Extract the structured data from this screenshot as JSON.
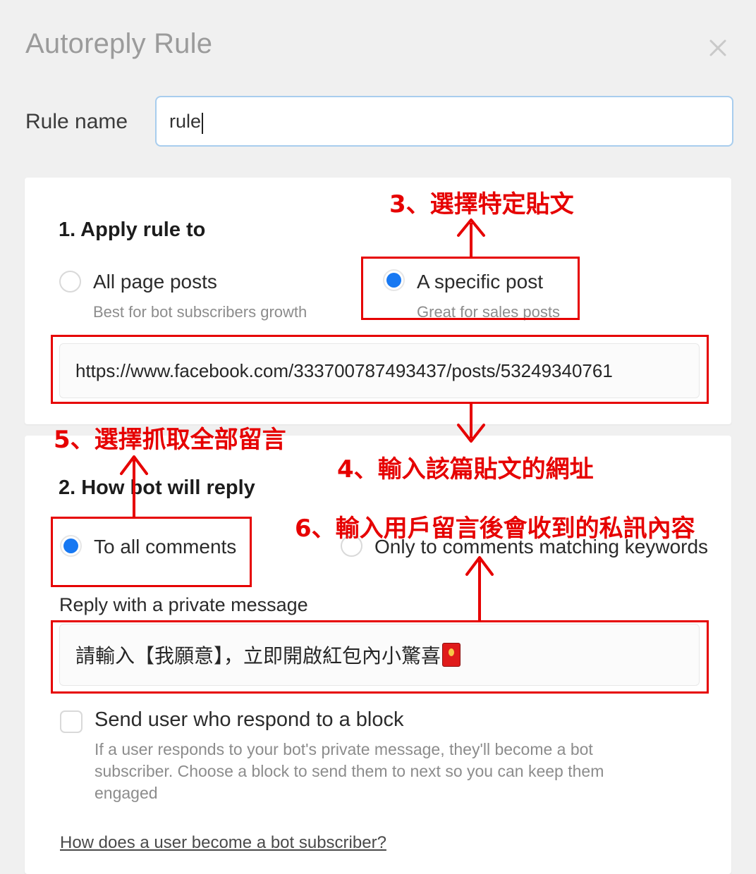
{
  "modal": {
    "title": "Autoreply Rule",
    "close_icon": "close-icon"
  },
  "rule_name": {
    "label": "Rule name",
    "value": "rule",
    "placeholder": "Rule name"
  },
  "apply_section": {
    "heading": "1. Apply rule to",
    "options": [
      {
        "label": "All page posts",
        "sub": "Best for bot subscribers growth",
        "selected": false
      },
      {
        "label": "A specific post",
        "sub": "Great for sales posts",
        "selected": true
      }
    ],
    "post_url": {
      "value": "https://www.facebook.com/333700787493437/posts/53249340761",
      "placeholder": "Paste post URL"
    }
  },
  "reply_section": {
    "heading": "2. How bot will reply",
    "options": [
      {
        "label": "To all comments",
        "selected": true
      },
      {
        "label": "Only to comments matching keywords",
        "selected": false
      }
    ],
    "private_message_label": "Reply with a private message",
    "private_message": {
      "value": "請輸入【我願意】，立即開啟紅包內小驚喜",
      "placeholder": "Type a private message"
    },
    "send_block": {
      "label": "Send user who respond to a block",
      "checked": false,
      "description": "If a user responds to your bot's private message, they'll become a bot subscriber. Choose a block to send them to next so you can keep them engaged"
    },
    "help_link": "How does a user become a bot subscriber?"
  },
  "annotations": {
    "color": "#e60000",
    "steps": [
      {
        "id": 3,
        "text": "3、選擇特定貼文"
      },
      {
        "id": 4,
        "text": "4、輸入該篇貼文的網址"
      },
      {
        "id": 5,
        "text": "5、選擇抓取全部留言"
      },
      {
        "id": 6,
        "text": "6、輸入用戶留言後會收到的私訊內容"
      }
    ]
  },
  "colors": {
    "accent_blue": "#1778f2",
    "annotation_red": "#e60000",
    "page_bg": "#f0f0f0",
    "card_bg": "#ffffff"
  }
}
